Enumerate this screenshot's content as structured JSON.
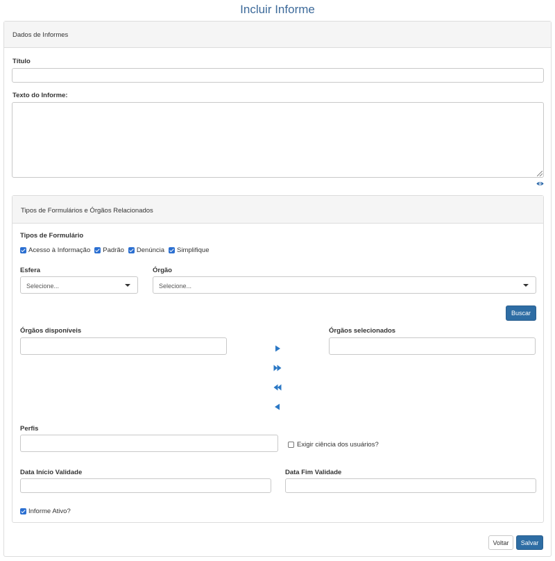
{
  "page": {
    "title": "Incluir Informe"
  },
  "dados": {
    "header": "Dados de Informes",
    "titulo_label": "Título",
    "titulo_value": "",
    "texto_label": "Texto do Informe:",
    "texto_value": ""
  },
  "tipos": {
    "header": "Tipos de Formulários e Órgãos Relacionados",
    "formulario_label": "Tipos de Formulário",
    "options": [
      {
        "label": "Acesso à Informação",
        "checked": true
      },
      {
        "label": "Padrão",
        "checked": true
      },
      {
        "label": "Denúncia",
        "checked": true
      },
      {
        "label": "Simplifique",
        "checked": true
      }
    ],
    "esfera_label": "Esfera",
    "esfera_placeholder": "Selecione...",
    "orgao_label": "Órgão",
    "orgao_placeholder": "Selecione...",
    "buscar_label": "Buscar",
    "disponiveis_label": "Órgãos disponíveis",
    "selecionados_label": "Órgãos selecionados",
    "perfis_label": "Perfis",
    "exigir_label": "Exigir ciência dos usuários?",
    "exigir_checked": false,
    "data_inicio_label": "Data Início Validade",
    "data_fim_label": "Data Fim Validade",
    "ativo_label": "Informe Ativo?",
    "ativo_checked": true
  },
  "footer": {
    "voltar_label": "Voltar",
    "salvar_label": "Salvar"
  },
  "colors": {
    "accent": "#2e6da4",
    "checkbox": "#2b6fd1",
    "arrow": "#2b78c5",
    "title": "#3d6a9a"
  },
  "icons": {
    "eye": "eye-icon",
    "move_right": "arrow-right-icon",
    "move_all_right": "double-arrow-right-icon",
    "move_all_left": "double-arrow-left-icon",
    "move_left": "arrow-left-icon",
    "dropdown": "caret-down-icon"
  }
}
